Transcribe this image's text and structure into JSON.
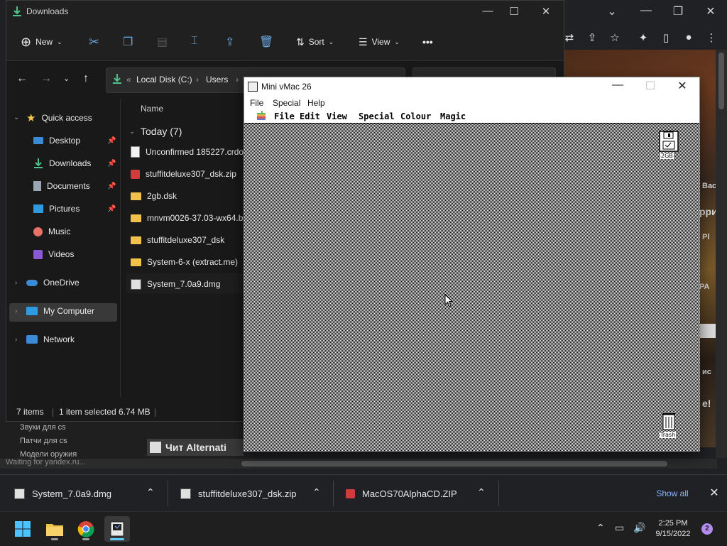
{
  "browser": {
    "status_text": "Waiting for yandex.ru...",
    "side_links": [
      "Звуки для cs",
      "Патчи для cs",
      "Модели оружия"
    ],
    "page_heading": "Чит Alternati",
    "right_snippets": [
      "Вас",
      "РА",
      "Pl",
      "ис",
      "e!",
      "рри"
    ],
    "tools": [
      "translate-icon",
      "share-icon",
      "star-icon",
      "extensions-icon",
      "sidebar-icon",
      "profile-icon",
      "menu-icon"
    ]
  },
  "explorer": {
    "title": "Downloads",
    "toolbar": {
      "new_label": "New",
      "sort_label": "Sort",
      "view_label": "View",
      "more_label": "•••"
    },
    "address": {
      "crumbs": [
        "Local Disk (C:)",
        "Users"
      ]
    },
    "nav": {
      "quick_access": "Quick access",
      "items": [
        {
          "label": "Desktop",
          "icon": "desktop-icon",
          "pinned": true
        },
        {
          "label": "Downloads",
          "icon": "download-icon",
          "pinned": true
        },
        {
          "label": "Documents",
          "icon": "documents-icon",
          "pinned": true
        },
        {
          "label": "Pictures",
          "icon": "pictures-icon",
          "pinned": true
        },
        {
          "label": "Music",
          "icon": "music-icon",
          "pinned": false
        },
        {
          "label": "Videos",
          "icon": "videos-icon",
          "pinned": false
        }
      ],
      "onedrive": "OneDrive",
      "my_computer": "My Computer",
      "network": "Network"
    },
    "content": {
      "column_name": "Name",
      "group_label": "Today (7)",
      "files": [
        {
          "name": "Unconfirmed 185227.crdownload",
          "icon": "file-icon"
        },
        {
          "name": "stuffitdeluxe307_dsk.zip",
          "icon": "zip-icon"
        },
        {
          "name": "2gb.dsk",
          "icon": "folder-icon"
        },
        {
          "name": "mnvm0026-37.03-wx64.bin",
          "icon": "folder-icon"
        },
        {
          "name": "stuffitdeluxe307_dsk",
          "icon": "folder-icon"
        },
        {
          "name": "System-6-x (extract.me)",
          "icon": "folder-icon"
        },
        {
          "name": "System_7.0a9.dmg",
          "icon": "disk-image-icon"
        }
      ]
    },
    "status": {
      "count": "7 items",
      "selected": "1 item selected",
      "size": "6.74 MB"
    }
  },
  "vmac": {
    "title": "Mini vMac 26",
    "menu": [
      "File",
      "Special",
      "Help"
    ],
    "mac_menu": [
      "File",
      "Edit",
      "View",
      "Special",
      "Colour",
      "Magic"
    ],
    "disk_label": "2GB",
    "trash_label": "Trash"
  },
  "downloads": {
    "items": [
      {
        "name": "System_7.0a9.dmg"
      },
      {
        "name": "stuffitdeluxe307_dsk.zip"
      },
      {
        "name": "MacOS70AlphaCD.ZIP"
      }
    ],
    "show_all": "Show all"
  },
  "taskbar": {
    "time": "2:25 PM",
    "date": "9/15/2022",
    "notifications": "2"
  },
  "colors": {
    "accent_blue": "#60cdff",
    "link_blue": "#8ab4f8",
    "explorer_bg": "#191919",
    "selection": "#393939"
  }
}
